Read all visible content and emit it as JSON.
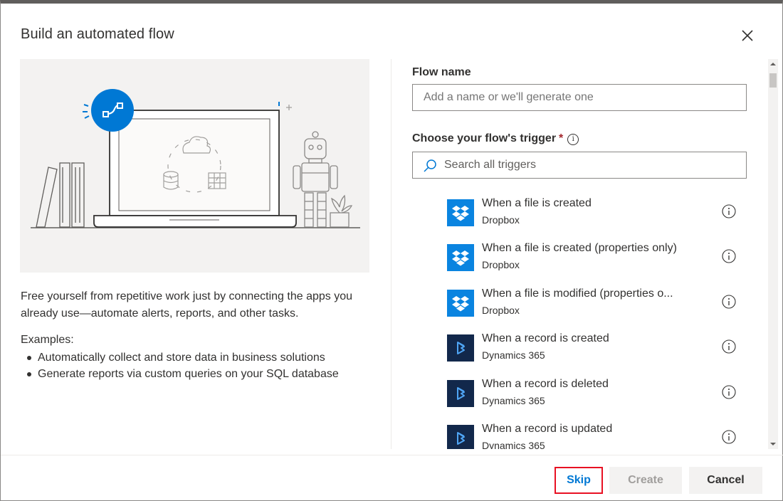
{
  "dialog": {
    "title": "Build an automated flow",
    "close_icon": "close-icon"
  },
  "left": {
    "description": "Free yourself from repetitive work just by connecting the apps you already use—automate alerts, reports, and other tasks.",
    "examples_label": "Examples:",
    "examples": [
      "Automatically collect and store data in business solutions",
      "Generate reports via custom queries on your SQL database"
    ]
  },
  "form": {
    "flow_name_label": "Flow name",
    "flow_name_value": "",
    "flow_name_placeholder": "Add a name or we'll generate one",
    "trigger_label": "Choose your flow's trigger",
    "required_mark": "*",
    "search_placeholder": "Search all triggers"
  },
  "triggers": [
    {
      "title": "When a file is created",
      "connector": "Dropbox",
      "icon": "dropbox-icon"
    },
    {
      "title": "When a file is created (properties only)",
      "connector": "Dropbox",
      "icon": "dropbox-icon"
    },
    {
      "title": "When a file is modified (properties o...",
      "connector": "Dropbox",
      "icon": "dropbox-icon"
    },
    {
      "title": "When a record is created",
      "connector": "Dynamics 365",
      "icon": "dynamics-365-icon"
    },
    {
      "title": "When a record is deleted",
      "connector": "Dynamics 365",
      "icon": "dynamics-365-icon"
    },
    {
      "title": "When a record is updated",
      "connector": "Dynamics 365",
      "icon": "dynamics-365-icon"
    }
  ],
  "footer": {
    "skip_label": "Skip",
    "create_label": "Create",
    "cancel_label": "Cancel"
  },
  "colors": {
    "accent": "#0078d4",
    "dropbox": "#0a84e0",
    "dynamics": "#12284b",
    "highlight": "#e81123"
  }
}
